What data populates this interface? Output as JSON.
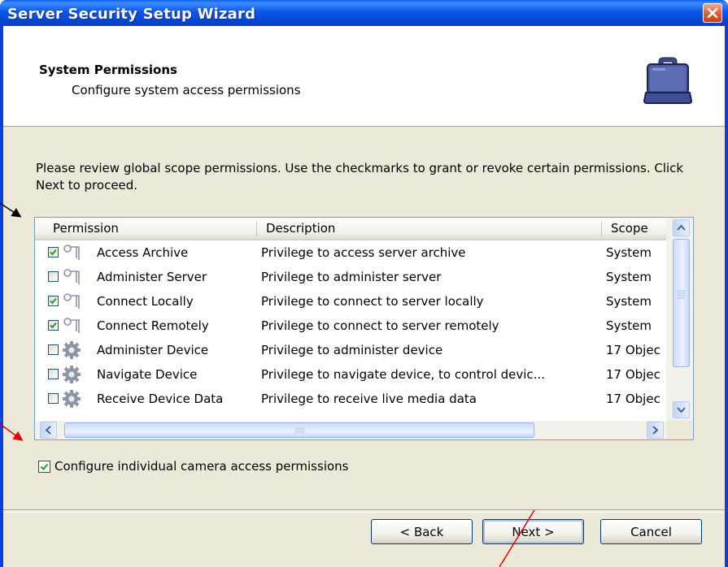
{
  "window": {
    "title": "Server Security Setup Wizard",
    "close_icon": "close-icon"
  },
  "header": {
    "title": "System Permissions",
    "subtitle": "Configure system access permissions",
    "icon": "briefcase-icon"
  },
  "intro_text": "Please review global scope permissions. Use the checkmarks to grant or revoke certain permissions. Click Next to proceed.",
  "list": {
    "columns": [
      "Permission",
      "Description",
      "Scope"
    ],
    "rows": [
      {
        "checked": true,
        "icon": "key-icon",
        "permission": "Access Archive",
        "description": "Privilege to access server archive",
        "scope": "System"
      },
      {
        "checked": false,
        "icon": "key-icon",
        "permission": "Administer Server",
        "description": "Privilege to administer server",
        "scope": "System"
      },
      {
        "checked": true,
        "icon": "key-icon",
        "permission": "Connect Locally",
        "description": "Privilege to connect to server locally",
        "scope": "System"
      },
      {
        "checked": true,
        "icon": "key-icon",
        "permission": "Connect Remotely",
        "description": "Privilege to connect to server remotely",
        "scope": "System"
      },
      {
        "checked": false,
        "icon": "gear-icon",
        "permission": "Administer Device",
        "description": "Privilege to administer device",
        "scope": "17 Objec"
      },
      {
        "checked": false,
        "icon": "gear-icon",
        "permission": "Navigate Device",
        "description": "Privilege to navigate device, to control devic...",
        "scope": "17 Objec"
      },
      {
        "checked": false,
        "icon": "gear-icon",
        "permission": "Receive Device Data",
        "description": "Privilege to receive live media data",
        "scope": "17 Objec"
      }
    ]
  },
  "configure_individual": {
    "checked": true,
    "label": "Configure individual camera access permissions"
  },
  "buttons": {
    "back": "< Back",
    "next": "Next >",
    "cancel": "Cancel"
  }
}
